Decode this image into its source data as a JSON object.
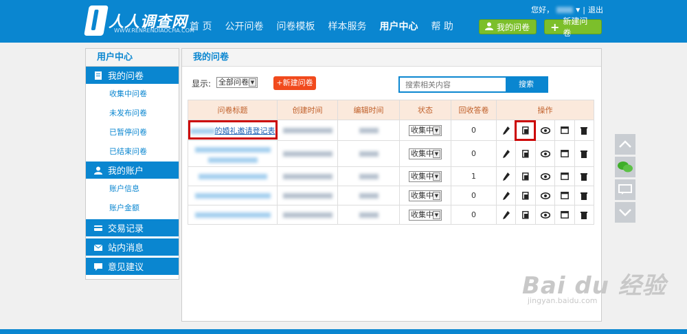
{
  "brand": {
    "name": "人人调查网",
    "tagline": "WWW.RENRENDIAOCHA.COM"
  },
  "userbar": {
    "greeting": "您好，",
    "logout": "退出"
  },
  "nav": [
    "首 页",
    "公开问卷",
    "问卷模板",
    "样本服务",
    "用户中心",
    "帮 助"
  ],
  "header_buttons": {
    "my_surveys": "我的问卷",
    "new_survey": "新建问卷"
  },
  "sidebar": {
    "title": "用户中心",
    "sections": [
      {
        "label": "我的问卷",
        "icon": "document-icon",
        "items": [
          "收集中问卷",
          "未发布问卷",
          "已暂停问卷",
          "已结束问卷"
        ]
      },
      {
        "label": "我的账户",
        "icon": "user-icon",
        "items": [
          "账户信息",
          "账户金额"
        ]
      },
      {
        "label": "交易记录",
        "icon": "card-icon",
        "items": []
      },
      {
        "label": "站内消息",
        "icon": "mail-icon",
        "items": []
      },
      {
        "label": "意见建议",
        "icon": "comment-icon",
        "items": []
      }
    ]
  },
  "main": {
    "title": "我的问卷",
    "show_label": "显示:",
    "show_select": "全部问卷",
    "new_button": "+新建问卷",
    "search_placeholder": "搜索相关内容",
    "search_button": "搜索"
  },
  "table": {
    "headers": [
      "问卷标题",
      "创建时间",
      "编辑时间",
      "状态",
      "回收答卷",
      "操作"
    ],
    "rows": [
      {
        "title_visible": "的婚礼邀请登记表",
        "status": "收集中",
        "count": "0"
      },
      {
        "title_visible": "",
        "status": "收集中",
        "count": "0"
      },
      {
        "title_visible": "",
        "status": "收集中",
        "count": "1"
      },
      {
        "title_visible": "",
        "status": "收集中",
        "count": "0"
      },
      {
        "title_visible": "",
        "status": "收集中",
        "count": "0"
      }
    ]
  },
  "watermark": {
    "main": "Bai du 经验",
    "sub": "jingyan.baidu.com"
  },
  "colors": {
    "primary": "#0a86d0",
    "green": "#7cbf2b",
    "red": "#f14a1d",
    "highlight": "#cc0000",
    "header_bg": "#fbe9dc"
  }
}
